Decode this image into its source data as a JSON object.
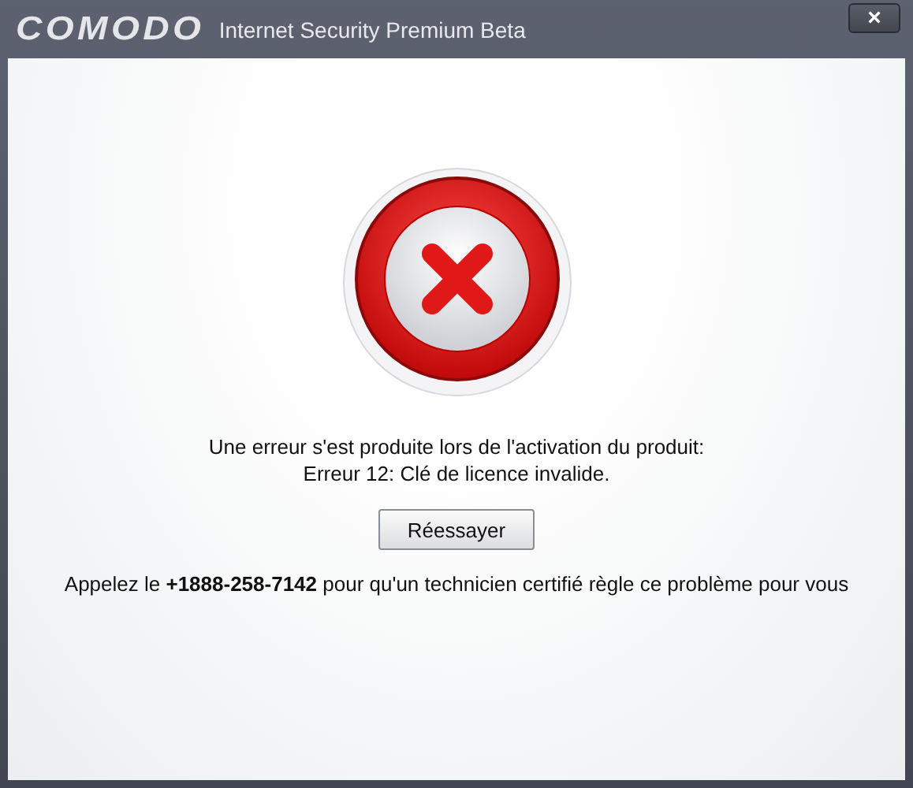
{
  "window": {
    "logo": "COMODO",
    "title": "Internet Security Premium Beta",
    "close": "×"
  },
  "message": [
    "Une erreur s'est produite lors de l'activation du produit:",
    "Erreur 12: Clé de licence invalide."
  ],
  "retry_button": "Réessayer",
  "support": "Appelez le **+1888-258-7142** pour qu'un technicien certifié règle ce problème pour vous"
}
